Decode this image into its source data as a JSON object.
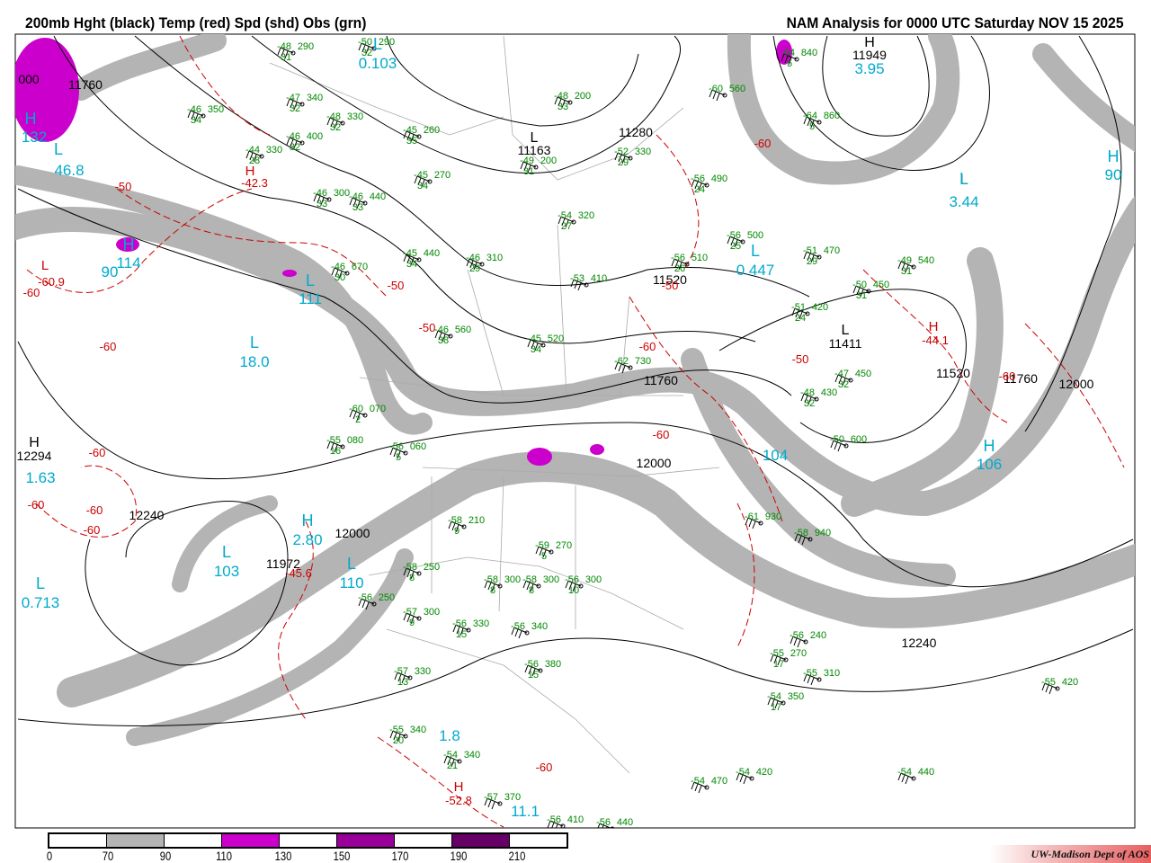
{
  "header": {
    "title_left": "200mb Hght (black) Temp (red) Spd (shd) Obs (grn)",
    "title_right": "NAM Analysis for 0000 UTC Saturday  NOV 15 2025"
  },
  "colors": {
    "height": "#000000",
    "temperature": "#cc0000",
    "speed_label": "#00aacc",
    "obs": "#008800",
    "shade_70_90": "#b4b4b4",
    "shade_110_130": "#cc00cc",
    "shade_150_170": "#990099",
    "shade_190_210": "#660066"
  },
  "legend": {
    "ticks": [
      "0",
      "70",
      "90",
      "110",
      "130",
      "150",
      "170",
      "190",
      "210"
    ]
  },
  "height_labels": [
    "000",
    "11760",
    "11949",
    "11163",
    "11280",
    "11520",
    "11520",
    "11760",
    "11760",
    "12000",
    "12000",
    "12000",
    "12240",
    "12240",
    "12294",
    "11972",
    "11411"
  ],
  "height_centers": [
    "H",
    "L",
    "L",
    "H",
    "L"
  ],
  "speed_labels": [
    "0.103",
    "46.8",
    "90",
    "114",
    "111",
    "18.0",
    "1.63",
    "2.80",
    "103",
    "110",
    "0.713",
    "3.95",
    "3.44",
    "0.447",
    "106",
    "90",
    "1.8",
    "11.1",
    "132",
    "104"
  ],
  "speed_centers": [
    "L",
    "L",
    "H",
    "H",
    "L",
    "L",
    "H",
    "L",
    "L",
    "L",
    "L",
    "L",
    "H",
    "H"
  ],
  "temp_labels": [
    "-42.3",
    "-60.9",
    "-44.1",
    "-45.6",
    "-52.8",
    "-50",
    "-60",
    "-60",
    "-60",
    "-60",
    "-60",
    "-60",
    "-50",
    "-60",
    "-60",
    "-50",
    "-60",
    "-50",
    "-50",
    "-60",
    "-60"
  ],
  "temp_centers": [
    "H",
    "L",
    "H",
    "H"
  ],
  "obs": [
    {
      "t": "-48",
      "z": "290",
      "d": "31"
    },
    {
      "t": "-50",
      "z": "290",
      "d": "32"
    },
    {
      "t": "-47",
      "z": "340",
      "d": "32"
    },
    {
      "t": "-46",
      "z": "350",
      "d": "34"
    },
    {
      "t": "-48",
      "z": "330",
      "d": "32"
    },
    {
      "t": "-46",
      "z": "400",
      "d": "32"
    },
    {
      "t": "-44",
      "z": "330",
      "d": "28"
    },
    {
      "t": "-45",
      "z": "260",
      "d": "35"
    },
    {
      "t": "-48",
      "z": "200",
      "d": "33"
    },
    {
      "t": "-49",
      "z": "200",
      "d": "31"
    },
    {
      "t": "-52",
      "z": "330",
      "d": "29"
    },
    {
      "t": "-45",
      "z": "270",
      "d": "34"
    },
    {
      "t": "-46",
      "z": "300",
      "d": "33"
    },
    {
      "t": "-46",
      "z": "440",
      "d": "33"
    },
    {
      "t": "-54",
      "z": "320",
      "d": "27"
    },
    {
      "t": "-56",
      "z": "490",
      "d": "24"
    },
    {
      "t": "-64",
      "z": "840",
      "d": "5"
    },
    {
      "t": "-60",
      "z": "560",
      "d": ""
    },
    {
      "t": "-64",
      "z": "860",
      "d": "5"
    },
    {
      "t": "-56",
      "z": "500",
      "d": "25"
    },
    {
      "t": "-51",
      "z": "470",
      "d": "29"
    },
    {
      "t": "-49",
      "z": "540",
      "d": "31"
    },
    {
      "t": "-50",
      "z": "450",
      "d": "31"
    },
    {
      "t": "-51",
      "z": "420",
      "d": "24"
    },
    {
      "t": "-56",
      "z": "510",
      "d": "26"
    },
    {
      "t": "-46",
      "z": "310",
      "d": "29"
    },
    {
      "t": "-45",
      "z": "440",
      "d": "34"
    },
    {
      "t": "-46",
      "z": "670",
      "d": "30"
    },
    {
      "t": "-53",
      "z": "410",
      "d": ""
    },
    {
      "t": "-46",
      "z": "560",
      "d": "38"
    },
    {
      "t": "-45",
      "z": "520",
      "d": "34"
    },
    {
      "t": "-62",
      "z": "730",
      "d": ""
    },
    {
      "t": "-60",
      "z": "070",
      "d": "2"
    },
    {
      "t": "-55",
      "z": "080",
      "d": "16"
    },
    {
      "t": "-56",
      "z": "060",
      "d": "5"
    },
    {
      "t": "-58",
      "z": "300",
      "d": "8"
    },
    {
      "t": "-56",
      "z": "330",
      "d": "15"
    },
    {
      "t": "-56",
      "z": "340",
      "d": ""
    },
    {
      "t": "-56",
      "z": "380",
      "d": "15"
    },
    {
      "t": "-57",
      "z": "330",
      "d": "13"
    },
    {
      "t": "-55",
      "z": "340",
      "d": "20"
    },
    {
      "t": "-54",
      "z": "340",
      "d": "21"
    },
    {
      "t": "-57",
      "z": "370",
      "d": ""
    },
    {
      "t": "-56",
      "z": "410",
      "d": ""
    },
    {
      "t": "-56",
      "z": "440",
      "d": ""
    },
    {
      "t": "-54",
      "z": "470",
      "d": ""
    },
    {
      "t": "-54",
      "z": "420",
      "d": ""
    },
    {
      "t": "-54",
      "z": "440",
      "d": ""
    },
    {
      "t": "-55",
      "z": "420",
      "d": ""
    },
    {
      "t": "-54",
      "z": "350",
      "d": "17"
    },
    {
      "t": "-55",
      "z": "310",
      "d": ""
    },
    {
      "t": "-55",
      "z": "270",
      "d": "17"
    },
    {
      "t": "-56",
      "z": "240",
      "d": ""
    },
    {
      "t": "-57",
      "z": "300",
      "d": "9"
    },
    {
      "t": "-58",
      "z": "250",
      "d": "8"
    },
    {
      "t": "-56",
      "z": "250",
      "d": ""
    },
    {
      "t": "-58",
      "z": "210",
      "d": "9"
    },
    {
      "t": "-59",
      "z": "270",
      "d": "5"
    },
    {
      "t": "-58",
      "z": "300",
      "d": "8"
    },
    {
      "t": "-56",
      "z": "300",
      "d": "10"
    },
    {
      "t": "-48",
      "z": "430",
      "d": "32"
    },
    {
      "t": "-47",
      "z": "450",
      "d": "32"
    },
    {
      "t": "-50",
      "z": "600",
      "d": ""
    },
    {
      "t": "-61",
      "z": "930",
      "d": ""
    },
    {
      "t": "-58",
      "z": "940",
      "d": ""
    }
  ],
  "credit": "UW-Madison   Dept of AOS"
}
